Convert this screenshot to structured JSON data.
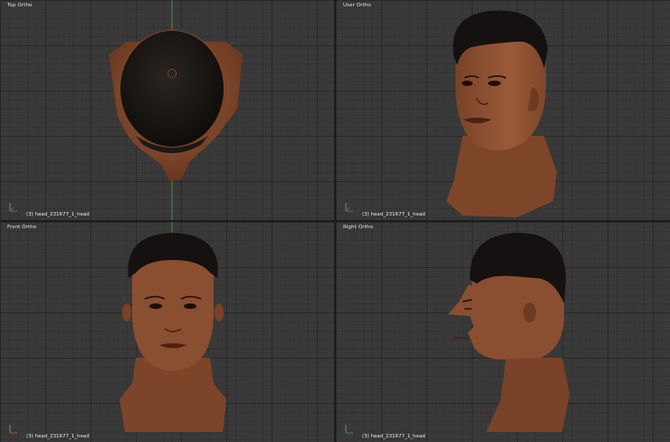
{
  "viewports": {
    "top_left": {
      "title": "Top Ortho",
      "object": "(3) head_231677_1_head"
    },
    "top_right": {
      "title": "User Ortho",
      "object": "(3) head_231677_1_head"
    },
    "bottom_left": {
      "title": "Front Ortho",
      "object": "(3) head_231677_1_head"
    },
    "bottom_right": {
      "title": "Right Ortho",
      "object": "(3) head_231677_1_head"
    }
  },
  "colors": {
    "viewport_bg": "#393939",
    "y_axis": "#5fa342",
    "x_axis": "#b5474a",
    "skin": "#8a4e30",
    "hair": "#171412",
    "cursor": "#e04a4a"
  },
  "icons": [
    "axis-gizmo-icon",
    "3d-cursor-icon"
  ]
}
